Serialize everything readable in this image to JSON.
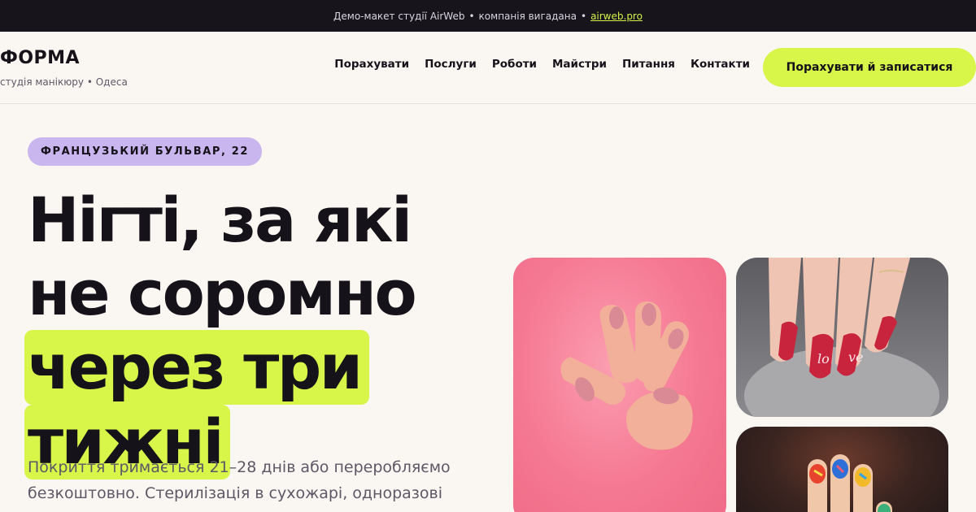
{
  "topbar": {
    "text": "Демо-макет студії AirWeb",
    "separator": "•",
    "note": "компанія вигадана",
    "link": "airweb.pro"
  },
  "brand": {
    "logo": "ФОРМА",
    "subtitle": "студія манікюру • Одеса"
  },
  "nav": {
    "items": [
      "Порахувати",
      "Послуги",
      "Роботи",
      "Майстри",
      "Питання",
      "Контакти"
    ],
    "cta": "Порахувати й записатися"
  },
  "hero": {
    "badge": "ФРАНЦУЗЬКИЙ БУЛЬВАР, 22",
    "headline_lines": [
      "Нігті, за які",
      "не соромно",
      "через три",
      "тижні"
    ],
    "lead": "Покриття тримається 21–28 днів або переробляємо безкоштовно. Стерилізація в сухожарі, одноразові"
  },
  "colors": {
    "accent": "#d8f54a",
    "badge": "#c9b6ef",
    "dark": "#17141c",
    "background": "#faf7f2"
  },
  "photos": [
    {
      "name": "pink-nails-photo",
      "icon": "image"
    },
    {
      "name": "love-nails-photo",
      "icon": "image"
    },
    {
      "name": "colorful-nails-photo",
      "icon": "image"
    }
  ]
}
